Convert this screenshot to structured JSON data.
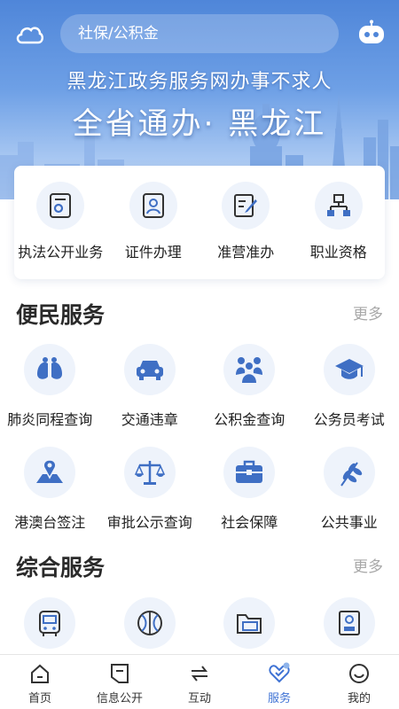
{
  "header": {
    "search_placeholder": "社保/公积金",
    "slogan_line1": "黑龙江政务服务网办事不求人",
    "slogan_line2": "全省通办· 黑龙江"
  },
  "quick_services": [
    {
      "label": "执法公开业务",
      "icon": "license-icon"
    },
    {
      "label": "证件办理",
      "icon": "id-card-icon"
    },
    {
      "label": "准营准办",
      "icon": "edit-doc-icon"
    },
    {
      "label": "职业资格",
      "icon": "org-chart-icon"
    }
  ],
  "convenience": {
    "title": "便民服务",
    "more": "更多",
    "items": [
      {
        "label": "肺炎同程查询",
        "icon": "lungs-icon"
      },
      {
        "label": "交通违章",
        "icon": "car-icon"
      },
      {
        "label": "公积金查询",
        "icon": "people-group-icon"
      },
      {
        "label": "公务员考试",
        "icon": "graduation-cap-icon"
      },
      {
        "label": "港澳台签注",
        "icon": "map-pin-icon"
      },
      {
        "label": "审批公示查询",
        "icon": "scales-icon"
      },
      {
        "label": "社会保障",
        "icon": "toolbox-icon"
      },
      {
        "label": "公共事业",
        "icon": "wheat-icon"
      }
    ]
  },
  "comprehensive": {
    "title": "综合服务",
    "more": "更多",
    "items": [
      {
        "label": "",
        "icon": "bus-icon"
      },
      {
        "label": "",
        "icon": "basketball-icon"
      },
      {
        "label": "",
        "icon": "folder-icon"
      },
      {
        "label": "",
        "icon": "certificate-icon"
      }
    ]
  },
  "bottom_nav": [
    {
      "label": "首页",
      "icon": "home-icon",
      "active": false
    },
    {
      "label": "信息公开",
      "icon": "info-icon",
      "active": false
    },
    {
      "label": "互动",
      "icon": "exchange-icon",
      "active": false
    },
    {
      "label": "服务",
      "icon": "heart-service-icon",
      "active": true
    },
    {
      "label": "我的",
      "icon": "profile-icon",
      "active": false
    }
  ],
  "colors": {
    "accent": "#3e72d4",
    "icon_blue": "#3f6fc4",
    "icon_bg": "#eef3fb",
    "banner_top": "#4f86d9"
  }
}
